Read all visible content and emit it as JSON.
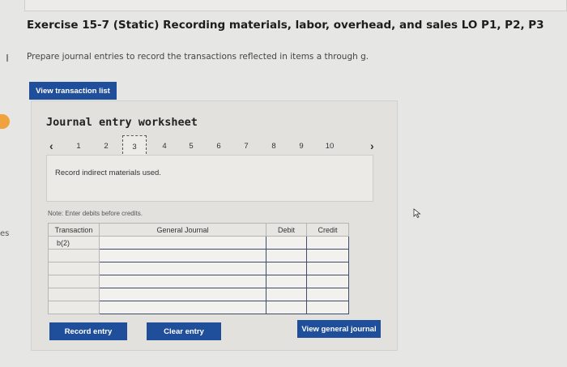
{
  "left_edge_text": "es",
  "exercise": {
    "title": "Exercise 15-7 (Static) Recording materials, labor, overhead, and sales LO P1, P2, P3",
    "instructions": "Prepare journal entries to record the transactions reflected in items a through g."
  },
  "buttons": {
    "view_transaction_list": "View transaction list",
    "record_entry": "Record entry",
    "clear_entry": "Clear entry",
    "view_general_journal": "View general journal"
  },
  "worksheet": {
    "title": "Journal entry worksheet",
    "pages": [
      "1",
      "2",
      "3",
      "4",
      "5",
      "6",
      "7",
      "8",
      "9",
      "10"
    ],
    "active_page": "3",
    "description": "Record indirect materials used.",
    "note": "Note: Enter debits before credits."
  },
  "journal": {
    "headers": {
      "transaction": "Transaction",
      "general_journal": "General Journal",
      "debit": "Debit",
      "credit": "Credit"
    },
    "rows": [
      {
        "transaction": "b(2)",
        "account": "",
        "debit": "",
        "credit": ""
      },
      {
        "transaction": "",
        "account": "",
        "debit": "",
        "credit": ""
      },
      {
        "transaction": "",
        "account": "",
        "debit": "",
        "credit": ""
      },
      {
        "transaction": "",
        "account": "",
        "debit": "",
        "credit": ""
      },
      {
        "transaction": "",
        "account": "",
        "debit": "",
        "credit": ""
      },
      {
        "transaction": "",
        "account": "",
        "debit": "",
        "credit": ""
      }
    ]
  },
  "colors": {
    "button_blue": "#1f4e9a",
    "marker_orange": "#f0a33c"
  }
}
